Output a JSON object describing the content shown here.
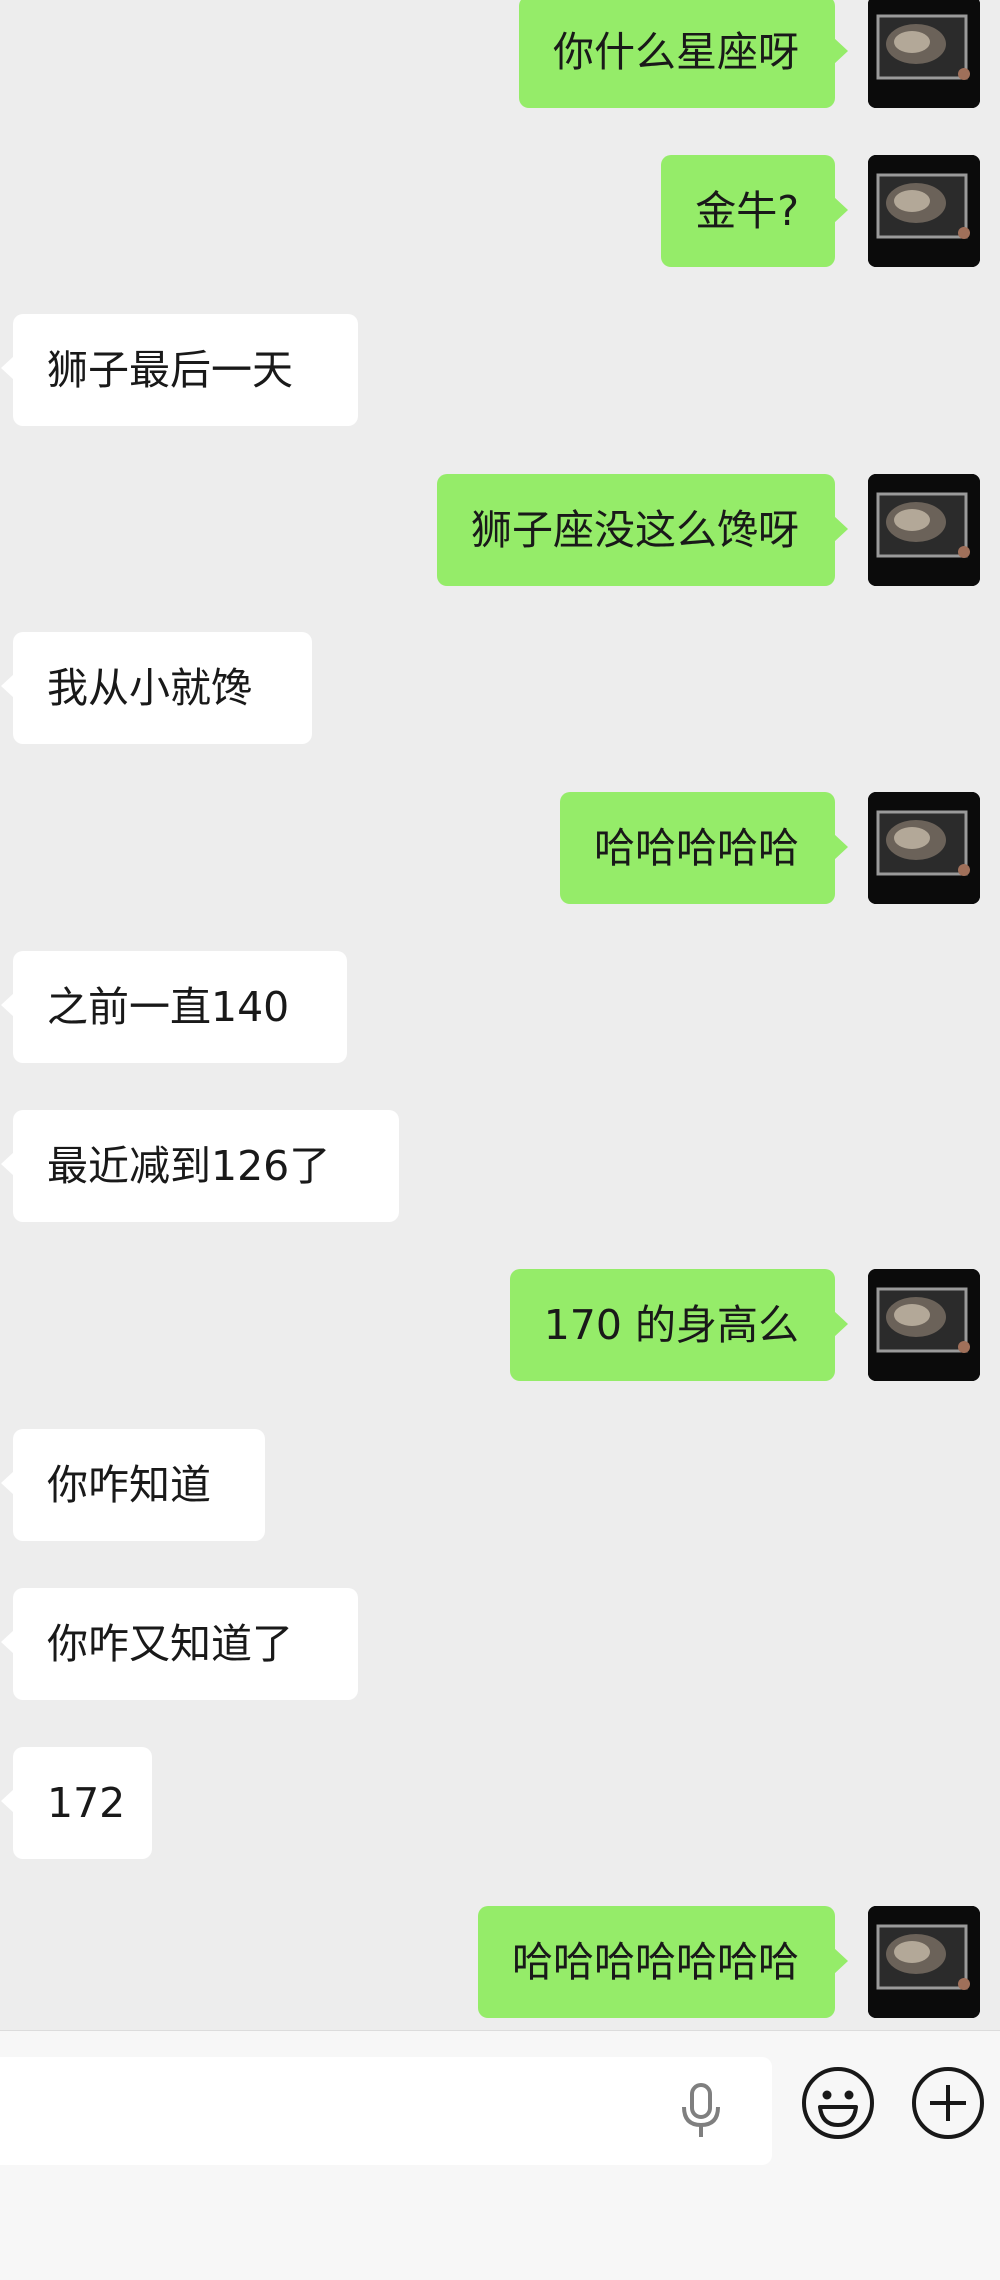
{
  "messages": [
    {
      "side": "sent",
      "text": "你什么星座呀"
    },
    {
      "side": "sent",
      "text": "金牛?"
    },
    {
      "side": "received",
      "text": "狮子最后一天"
    },
    {
      "side": "sent",
      "text": "狮子座没这么馋呀"
    },
    {
      "side": "received",
      "text": "我从小就馋"
    },
    {
      "side": "sent",
      "text": "哈哈哈哈哈"
    },
    {
      "side": "received",
      "text": "之前一直140"
    },
    {
      "side": "received",
      "text": "最近减到126了"
    },
    {
      "side": "sent",
      "text": "170 的身高么"
    },
    {
      "side": "received",
      "text": "你咋知道"
    },
    {
      "side": "received",
      "text": "你咋又知道了"
    },
    {
      "side": "received",
      "text": "172"
    },
    {
      "side": "sent",
      "text": "哈哈哈哈哈哈哈"
    }
  ],
  "input_bar": {
    "message_input": {
      "value": "",
      "placeholder": ""
    },
    "icons": [
      "voice-icon",
      "emoji-icon",
      "plus-icon"
    ]
  },
  "colors": {
    "chat_background": "#ededed",
    "sent_bubble": "#95ec69",
    "received_bubble": "#ffffff",
    "text": "#191919"
  }
}
